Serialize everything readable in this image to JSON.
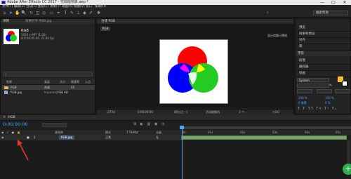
{
  "window": {
    "title": "Adobe After Effects CC 2017 - 无标题项目.aep *",
    "minimize": "—",
    "maximize": "□",
    "close": "✕"
  },
  "menu": [
    "文件(F)",
    "编辑(E)",
    "合成(C)",
    "图层(L)",
    "效果(T)",
    "动画(A)",
    "视图(V)",
    "窗口",
    "帮助(H)"
  ],
  "toolbar": {
    "search_placeholder": "搜索帮助",
    "tools": [
      "home-icon",
      "selection-tool-icon",
      "hand-tool-icon",
      "zoom-tool-icon",
      "rotate-tool-icon",
      "camera-tool-icon",
      "pan-behind-tool-icon",
      "pen-tool-icon",
      "text-tool-icon",
      "brush-tool-icon",
      "clone-stamp-tool-icon",
      "eraser-tool-icon",
      "roto-brush-tool-icon",
      "puppet-tool-icon"
    ]
  },
  "project": {
    "tab": "项目",
    "tab_extra": "效果控件 RGB.jpg",
    "selected_name": "RGB",
    "info_line1": "1024 x 997 (1.00)",
    "info_line2": "Δ 0:00:05:00, 25.00 fps",
    "columns": {
      "name": "名称",
      "type": "类型",
      "size": "大小",
      "fps": "帧速率",
      "in": "入点"
    },
    "rows": [
      {
        "name": "RGB",
        "type": "合成",
        "size": "",
        "fps": "25",
        "in": ""
      },
      {
        "name": "RGB.jpg",
        "type": "ImporterJPEG",
        "size": "31 KB",
        "fps": "",
        "in": ""
      }
    ],
    "bpc": "8 bpc"
  },
  "composition": {
    "tab": "合成 RGB",
    "chip": "RGB",
    "bottom": [
      "(37%)",
      "0:00:00:00",
      "(四分之一)",
      "活动摄像机",
      "1 个...",
      "+0.0"
    ]
  },
  "right_panel": {
    "items": [
      "预览",
      "效果和预设",
      "对齐",
      "库",
      "字符",
      "段落",
      "跟踪器",
      "绘画"
    ],
    "font_label": "System",
    "metrics": [
      "100 %",
      "100 %",
      "0 像素",
      "0 %"
    ]
  },
  "right_panel_side_label": "显示加载已预帧",
  "timeline": {
    "tab": "RGB",
    "timecode": "0:00:00:00",
    "columns": {
      "src": "源名称",
      "mode": "模式",
      "trk": "T TrkMat",
      "parent": "父级"
    },
    "layer": {
      "index": "1",
      "name": "RGB.jpg",
      "mode": "正常",
      "parent": "无"
    },
    "ruler": [
      "0s",
      "01s",
      "02s",
      "03s",
      "04s",
      "05s"
    ]
  },
  "colors": {
    "accent": "#4aa3ff",
    "layer_bar": "#79a66e",
    "annotation_arrow": "#e53c2e",
    "fab": "#2fae50",
    "text_color_swatch": "#ffc21a"
  },
  "fab_icon": "+"
}
